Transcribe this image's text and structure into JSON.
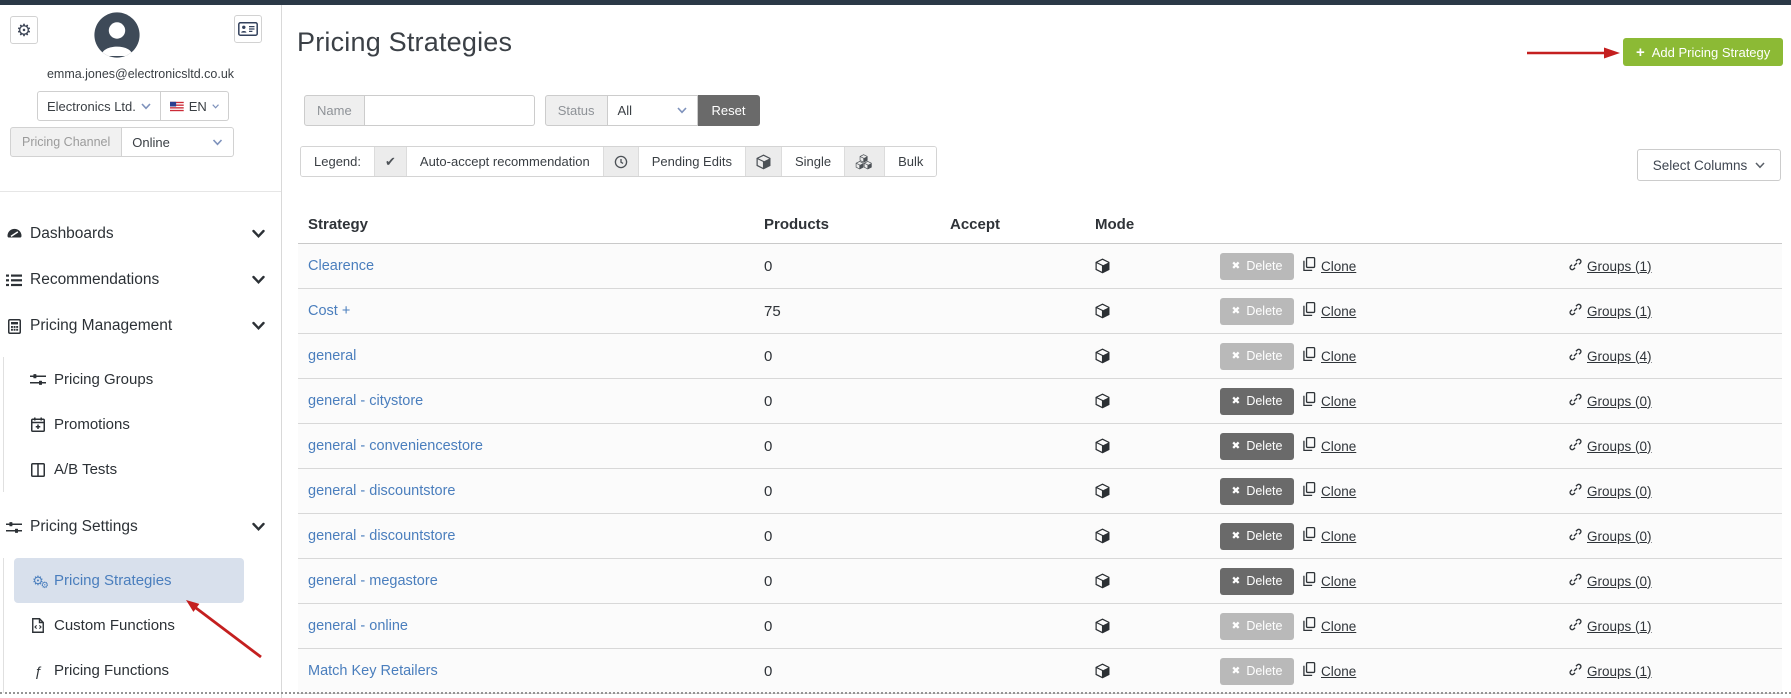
{
  "colors": {
    "topbar": "#2b3947",
    "accent_green": "#8cba35",
    "link_blue": "#4a7ebd",
    "arrow_red": "#c41f1f",
    "active_item_bg": "#d8e0ec",
    "button_dark": "#6a6a6a",
    "button_disabled": "#b9b9b9"
  },
  "sidebar": {
    "email": "emma.jones@electronicsltd.co.uk",
    "company_select": "Electronics Ltd.",
    "language_select": "EN",
    "language_flag_icon": "us-flag",
    "pricing_channel_label": "Pricing Channel",
    "pricing_channel_value": "Online",
    "nav": [
      {
        "label": "Dashboards",
        "icon": "gauge",
        "chevron": true
      },
      {
        "label": "Recommendations",
        "icon": "list",
        "chevron": true
      },
      {
        "label": "Pricing Management",
        "icon": "calculator",
        "chevron": true,
        "children": [
          {
            "label": "Pricing Groups",
            "icon": "sliders"
          },
          {
            "label": "Promotions",
            "icon": "calendar-plus"
          },
          {
            "label": "A/B Tests",
            "icon": "columns"
          }
        ]
      },
      {
        "label": "Pricing Settings",
        "icon": "sliders",
        "chevron": true,
        "children": [
          {
            "label": "Pricing Strategies",
            "icon": "gears",
            "active": true
          },
          {
            "label": "Custom Functions",
            "icon": "file-code"
          },
          {
            "label": "Pricing Functions",
            "icon": "function"
          }
        ]
      }
    ]
  },
  "header": {
    "title": "Pricing Strategies",
    "add_button": "Add Pricing Strategy",
    "add_button_icon": "plus"
  },
  "filters": {
    "name_label": "Name",
    "name_value": "",
    "status_label": "Status",
    "status_value": "All",
    "reset_label": "Reset"
  },
  "legend": {
    "label": "Legend:",
    "items": [
      {
        "icon": "check",
        "label": "Auto-accept recommendation"
      },
      {
        "icon": "clock",
        "label": "Pending Edits"
      },
      {
        "icon": "cube",
        "label": "Single"
      },
      {
        "icon": "cubes",
        "label": "Bulk"
      }
    ]
  },
  "columns_button": "Select Columns",
  "table": {
    "headers": [
      "Strategy",
      "Products",
      "Accept",
      "Mode"
    ],
    "actions": {
      "delete": "Delete",
      "delete_icon": "x",
      "clone": "Clone",
      "clone_icon": "copy",
      "groups_icon": "link"
    },
    "rows": [
      {
        "name": "Clearence",
        "products": "0",
        "mode": "single",
        "delete_enabled": false,
        "groups": "Groups (1)"
      },
      {
        "name": "Cost +",
        "products": "75",
        "mode": "single",
        "delete_enabled": false,
        "groups": "Groups (1)"
      },
      {
        "name": "general",
        "products": "0",
        "mode": "single",
        "delete_enabled": false,
        "groups": "Groups (4)"
      },
      {
        "name": "general - citystore",
        "products": "0",
        "mode": "single",
        "delete_enabled": true,
        "groups": "Groups (0)"
      },
      {
        "name": "general - conveniencestore",
        "products": "0",
        "mode": "single",
        "delete_enabled": true,
        "groups": "Groups (0)"
      },
      {
        "name": "general - discountstore",
        "products": "0",
        "mode": "single",
        "delete_enabled": true,
        "groups": "Groups (0)"
      },
      {
        "name": "general - discountstore",
        "products": "0",
        "mode": "single",
        "delete_enabled": true,
        "groups": "Groups (0)"
      },
      {
        "name": "general - megastore",
        "products": "0",
        "mode": "single",
        "delete_enabled": true,
        "groups": "Groups (0)"
      },
      {
        "name": "general - online",
        "products": "0",
        "mode": "single",
        "delete_enabled": false,
        "groups": "Groups (1)"
      },
      {
        "name": "Match Key Retailers",
        "products": "0",
        "mode": "single",
        "delete_enabled": false,
        "groups": "Groups (1)"
      }
    ]
  },
  "annotations": {
    "arrow_to_add_button": "red-arrow",
    "arrow_to_pricing_strategies": "red-arrow"
  }
}
